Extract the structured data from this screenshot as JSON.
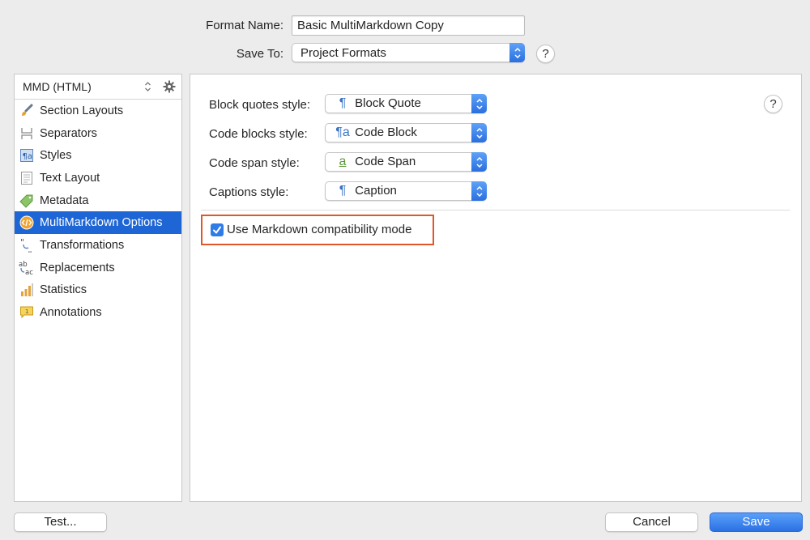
{
  "form": {
    "format_name_label": "Format Name:",
    "format_name_value": "Basic MultiMarkdown Copy",
    "save_to_label": "Save To:",
    "save_to_value": "Project Formats",
    "help": "?"
  },
  "sidebar": {
    "selector": "MMD (HTML)",
    "items": [
      {
        "label": "Section Layouts",
        "icon": "brush-icon"
      },
      {
        "label": "Separators",
        "icon": "separator-icon"
      },
      {
        "label": "Styles",
        "icon": "styles-icon"
      },
      {
        "label": "Text Layout",
        "icon": "text-layout-icon"
      },
      {
        "label": "Metadata",
        "icon": "tag-icon"
      },
      {
        "label": "MultiMarkdown Options",
        "icon": "code-badge-icon",
        "selected": true
      },
      {
        "label": "Transformations",
        "icon": "quotes-icon"
      },
      {
        "label": "Replacements",
        "icon": "replace-icon"
      },
      {
        "label": "Statistics",
        "icon": "bar-chart-icon"
      },
      {
        "label": "Annotations",
        "icon": "comment-icon"
      }
    ]
  },
  "main": {
    "help": "?",
    "rows": [
      {
        "label": "Block quotes style:",
        "glyph": "¶",
        "value": "Block Quote"
      },
      {
        "label": "Code blocks style:",
        "glyph": "¶a",
        "value": "Code Block"
      },
      {
        "label": "Code span style:",
        "glyph": "a",
        "value": "Code Span"
      },
      {
        "label": "Captions style:",
        "glyph": "¶",
        "value": "Caption"
      }
    ],
    "checkbox_label": "Use Markdown compatibility mode",
    "checkbox_checked": true
  },
  "buttons": {
    "test": "Test...",
    "cancel": "Cancel",
    "save": "Save"
  },
  "colors": {
    "accent": "#1e66d6",
    "highlight": "#e0572a"
  }
}
